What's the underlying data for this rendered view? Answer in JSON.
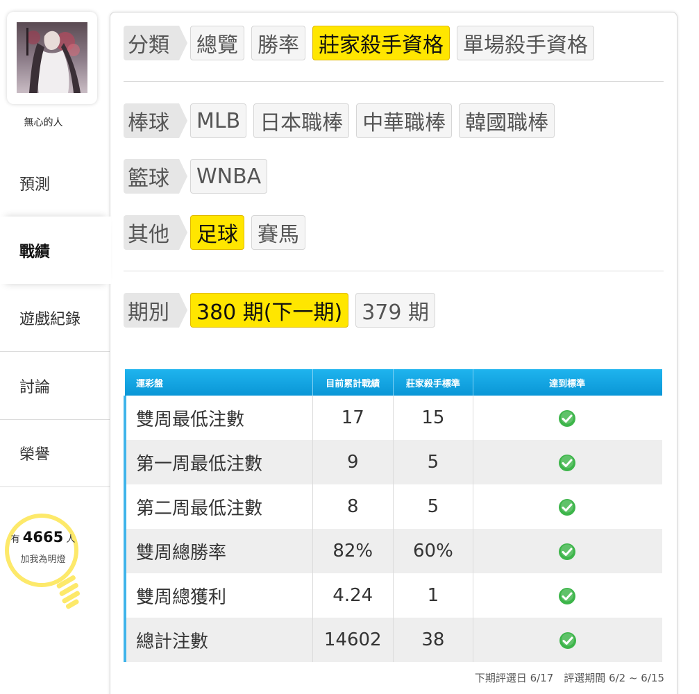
{
  "user": {
    "name": "無心的人"
  },
  "nav": [
    {
      "label": "預測"
    },
    {
      "label": "戰績"
    },
    {
      "label": "遊戲紀錄"
    },
    {
      "label": "討論"
    },
    {
      "label": "榮譽"
    }
  ],
  "fans": {
    "prefix": "有",
    "count": "4665",
    "suffix": "人",
    "caption": "加我為明燈"
  },
  "filters": {
    "category": {
      "label": "分類",
      "options": [
        "總覽",
        "勝率",
        "莊家殺手資格",
        "單場殺手資格"
      ],
      "selected": "莊家殺手資格"
    },
    "baseball": {
      "label": "棒球",
      "options": [
        "MLB",
        "日本職棒",
        "中華職棒",
        "韓國職棒"
      ]
    },
    "basketball": {
      "label": "籃球",
      "options": [
        "WNBA"
      ]
    },
    "other": {
      "label": "其他",
      "options": [
        "足球",
        "賽馬"
      ],
      "selected": "足球"
    },
    "period": {
      "label": "期別",
      "options": [
        "380 期(下一期)",
        "379 期"
      ],
      "selected": "380 期(下一期)"
    }
  },
  "table": {
    "headers": [
      "運彩盤",
      "目前累計戰績",
      "莊家殺手標準",
      "達到標準"
    ],
    "rows": [
      {
        "name": "雙周最低注數",
        "current": "17",
        "standard": "15",
        "met": "check-icon"
      },
      {
        "name": "第一周最低注數",
        "current": "9",
        "standard": "5",
        "met": "check-icon"
      },
      {
        "name": "第二周最低注數",
        "current": "8",
        "standard": "5",
        "met": "check-icon"
      },
      {
        "name": "雙周總勝率",
        "current": "82%",
        "standard": "60%",
        "met": "check-icon"
      },
      {
        "name": "雙周總獲利",
        "current": "4.24",
        "standard": "1",
        "met": "check-icon"
      },
      {
        "name": "總計注數",
        "current": "14602",
        "standard": "38",
        "met": "check-icon"
      }
    ]
  },
  "footer": {
    "note": "下期評選日 6/17　評選期間 6/2 ~ 6/15"
  },
  "colors": {
    "accent_yellow": "#ffe600",
    "header_blue": "#0a96d6",
    "check_green": "#3db54a"
  }
}
